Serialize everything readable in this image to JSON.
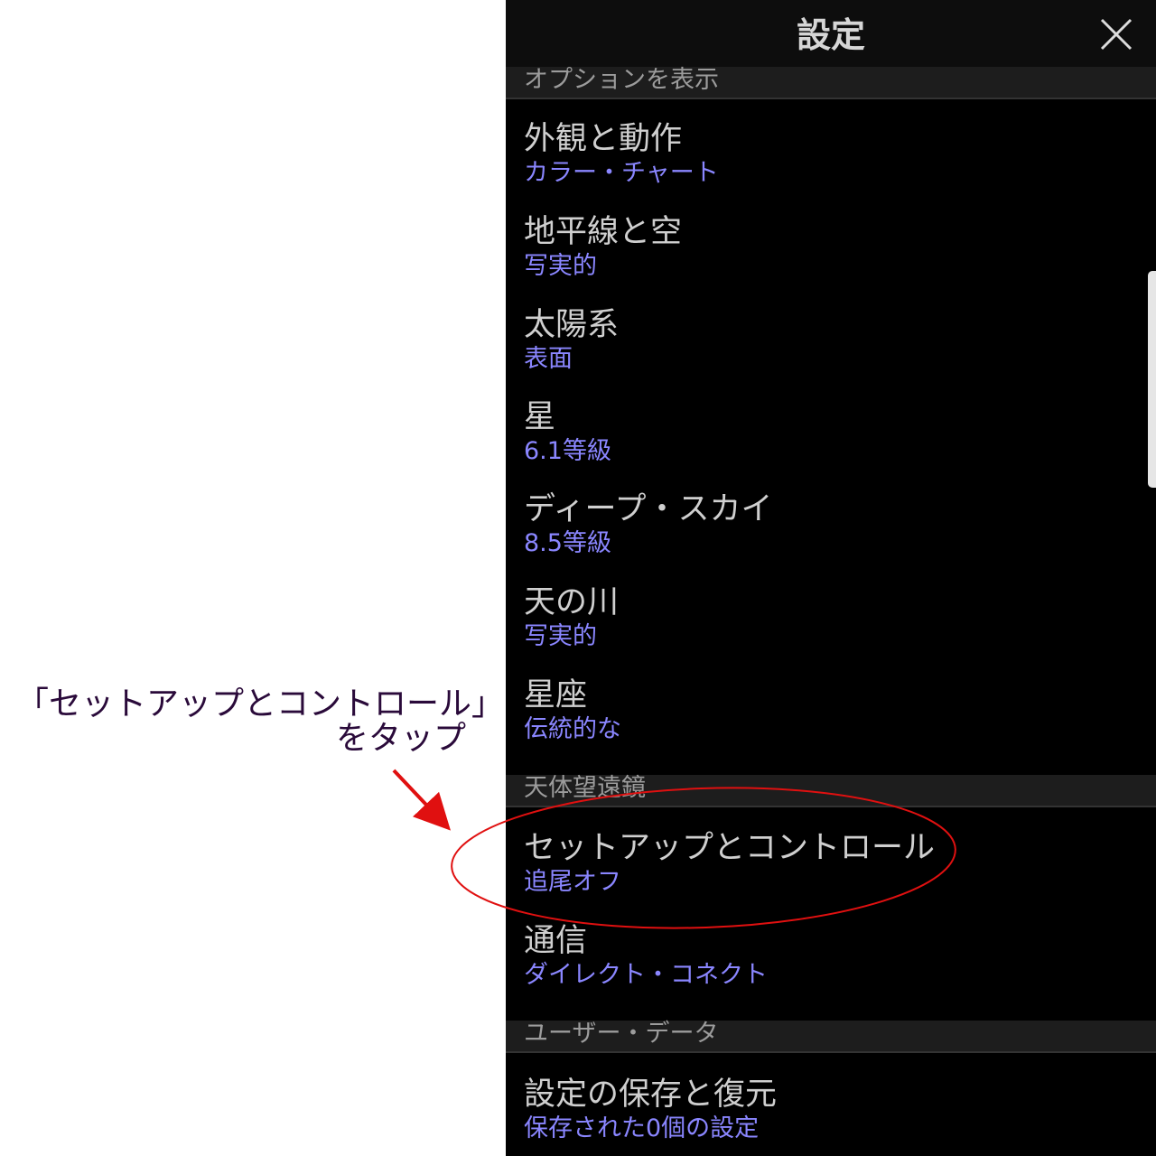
{
  "annotation": {
    "line1": "「セットアップとコントロール」",
    "line2": "をタップ",
    "color": "#2a0a3a",
    "highlight_color": "#e01010"
  },
  "header": {
    "title": "設定",
    "close_icon": "close-icon"
  },
  "sections": [
    {
      "label": "オプションを表示"
    },
    {
      "label": "天体望遠鏡"
    },
    {
      "label": "ユーザー・データ"
    }
  ],
  "items": [
    {
      "title": "外観と動作",
      "value": "カラー・チャート"
    },
    {
      "title": "地平線と空",
      "value": "写実的"
    },
    {
      "title": "太陽系",
      "value": "表面"
    },
    {
      "title": "星",
      "value": "6.1等級"
    },
    {
      "title": "ディープ・スカイ",
      "value": "8.5等級"
    },
    {
      "title": "天の川",
      "value": "写実的"
    },
    {
      "title": "星座",
      "value": "伝統的な"
    },
    {
      "title": "セットアップとコントロール",
      "value": "追尾オフ"
    },
    {
      "title": "通信",
      "value": "ダイレクト・コネクト"
    },
    {
      "title": "設定の保存と復元",
      "value": "保存された0個の設定"
    }
  ],
  "colors": {
    "panel_bg": "#000000",
    "header_bg": "#0d0d0d",
    "section_bg": "#1d1d1d",
    "title_text": "#cfcfcf",
    "value_text": "#8a86ff"
  }
}
